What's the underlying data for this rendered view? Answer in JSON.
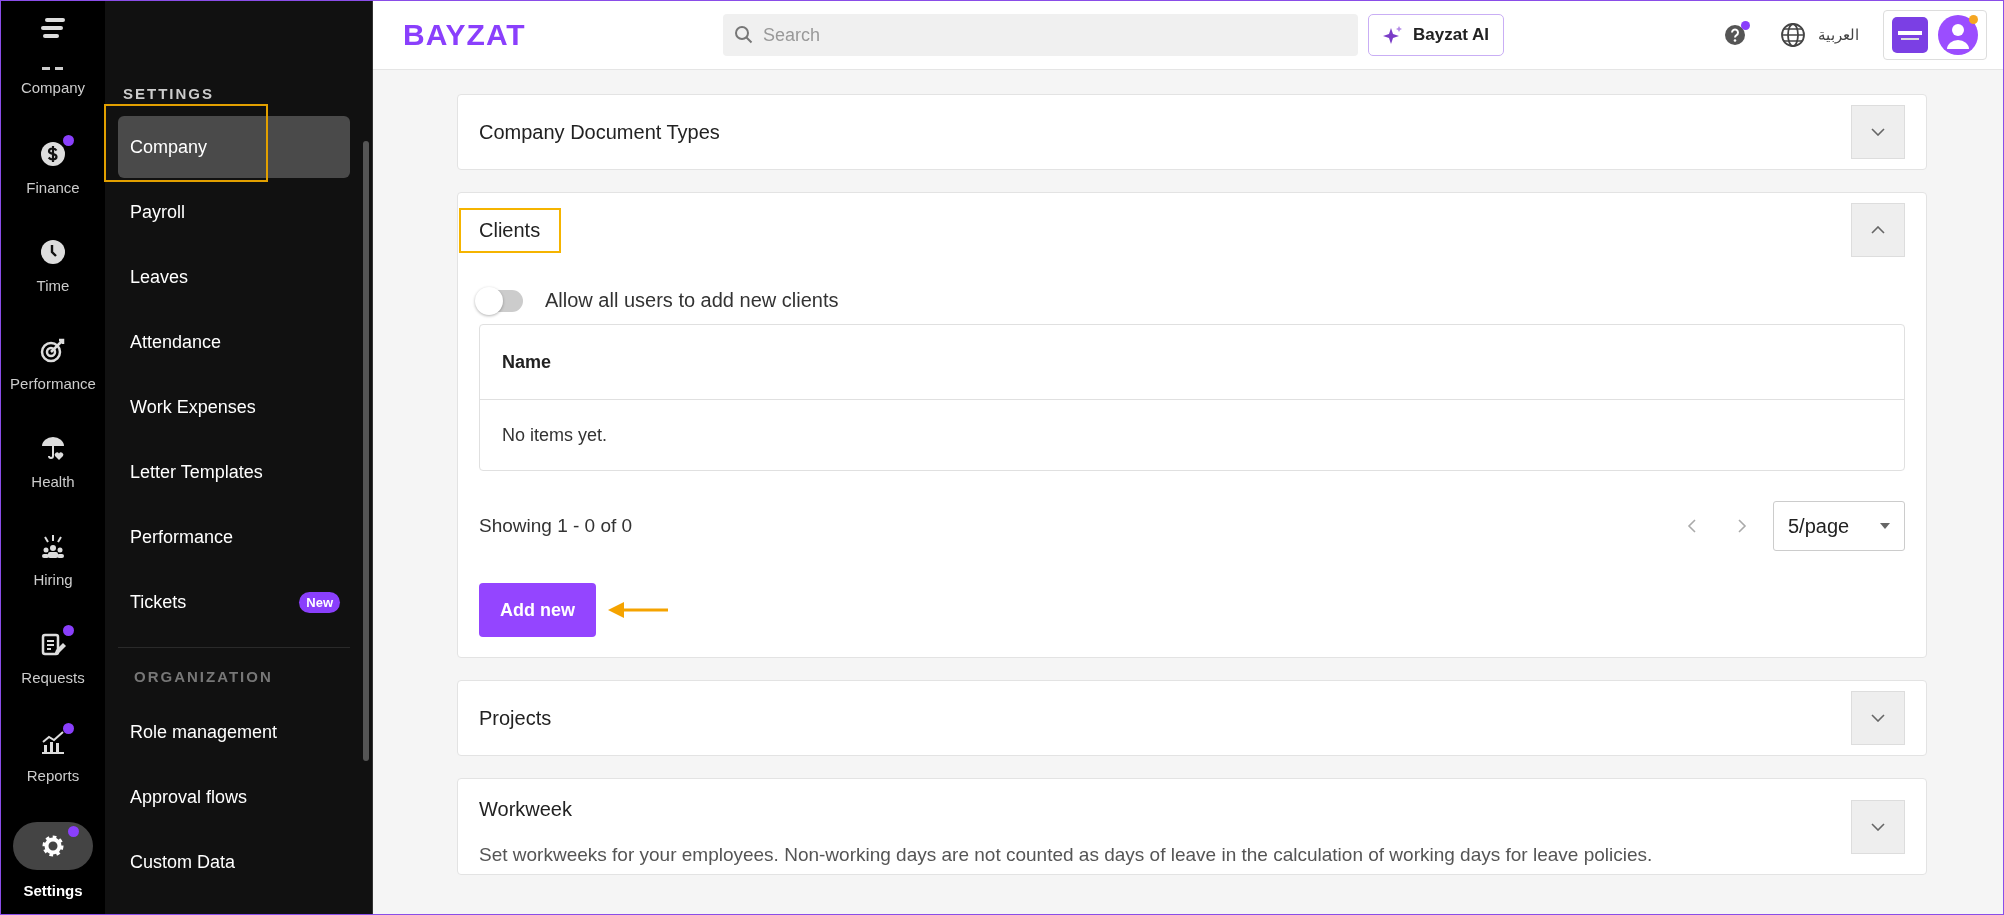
{
  "rail": {
    "items": [
      {
        "label": "Company",
        "kind": "company",
        "selected": false,
        "notification": false
      },
      {
        "label": "Finance",
        "kind": "finance",
        "selected": false,
        "notification": true
      },
      {
        "label": "Time",
        "kind": "time",
        "selected": false,
        "notification": false
      },
      {
        "label": "Performance",
        "kind": "performance",
        "selected": false,
        "notification": false
      },
      {
        "label": "Health",
        "kind": "health",
        "selected": false,
        "notification": false
      },
      {
        "label": "Hiring",
        "kind": "hiring",
        "selected": false,
        "notification": false
      },
      {
        "label": "Requests",
        "kind": "requests",
        "selected": false,
        "notification": true
      },
      {
        "label": "Reports",
        "kind": "reports",
        "selected": false,
        "notification": true
      },
      {
        "label": "Settings",
        "kind": "settings",
        "selected": true,
        "notification": true
      }
    ]
  },
  "menu": {
    "groups": [
      {
        "title": "SETTINGS",
        "items": [
          {
            "label": "Company",
            "selected": true,
            "highlighted": true
          },
          {
            "label": "Payroll",
            "selected": false,
            "highlighted": false
          },
          {
            "label": "Leaves",
            "selected": false,
            "highlighted": false
          },
          {
            "label": "Attendance",
            "selected": false,
            "highlighted": false
          },
          {
            "label": "Work Expenses",
            "selected": false,
            "highlighted": false
          },
          {
            "label": "Letter Templates",
            "selected": false,
            "highlighted": false
          },
          {
            "label": "Performance",
            "selected": false,
            "highlighted": false
          },
          {
            "label": "Tickets",
            "selected": false,
            "highlighted": false,
            "badge": "New"
          }
        ]
      },
      {
        "title": "ORGANIZATION",
        "items": [
          {
            "label": "Role management",
            "selected": false,
            "highlighted": false
          },
          {
            "label": "Approval flows",
            "selected": false,
            "highlighted": false
          },
          {
            "label": "Custom Data",
            "selected": false,
            "highlighted": false
          }
        ]
      }
    ]
  },
  "topbar": {
    "logo": "BAYZAT",
    "search": {
      "placeholder": "Search"
    },
    "ai_button": "Bayzat AI",
    "language": "العربية",
    "help_notification": true,
    "avatar_notification": true
  },
  "sections": [
    {
      "title": "Company Document Types",
      "expanded": false,
      "highlighted": false
    },
    {
      "title": "Clients",
      "expanded": true,
      "highlighted": true,
      "toggle": {
        "label": "Allow all users to add new clients",
        "on": false
      },
      "table": {
        "columns": [
          "Name"
        ],
        "empty": "No items yet."
      },
      "pagination": {
        "summary": "Showing 1 - 0 of 0",
        "page_size": "5/page"
      },
      "add_button": {
        "label": "Add new",
        "annotated": true
      }
    },
    {
      "title": "Projects",
      "expanded": false,
      "highlighted": false
    },
    {
      "title": "Workweek",
      "expanded": false,
      "highlighted": false,
      "description": "Set workweeks for your employees. Non-working days are not counted as days of leave in the calculation of working days for leave policies."
    }
  ]
}
